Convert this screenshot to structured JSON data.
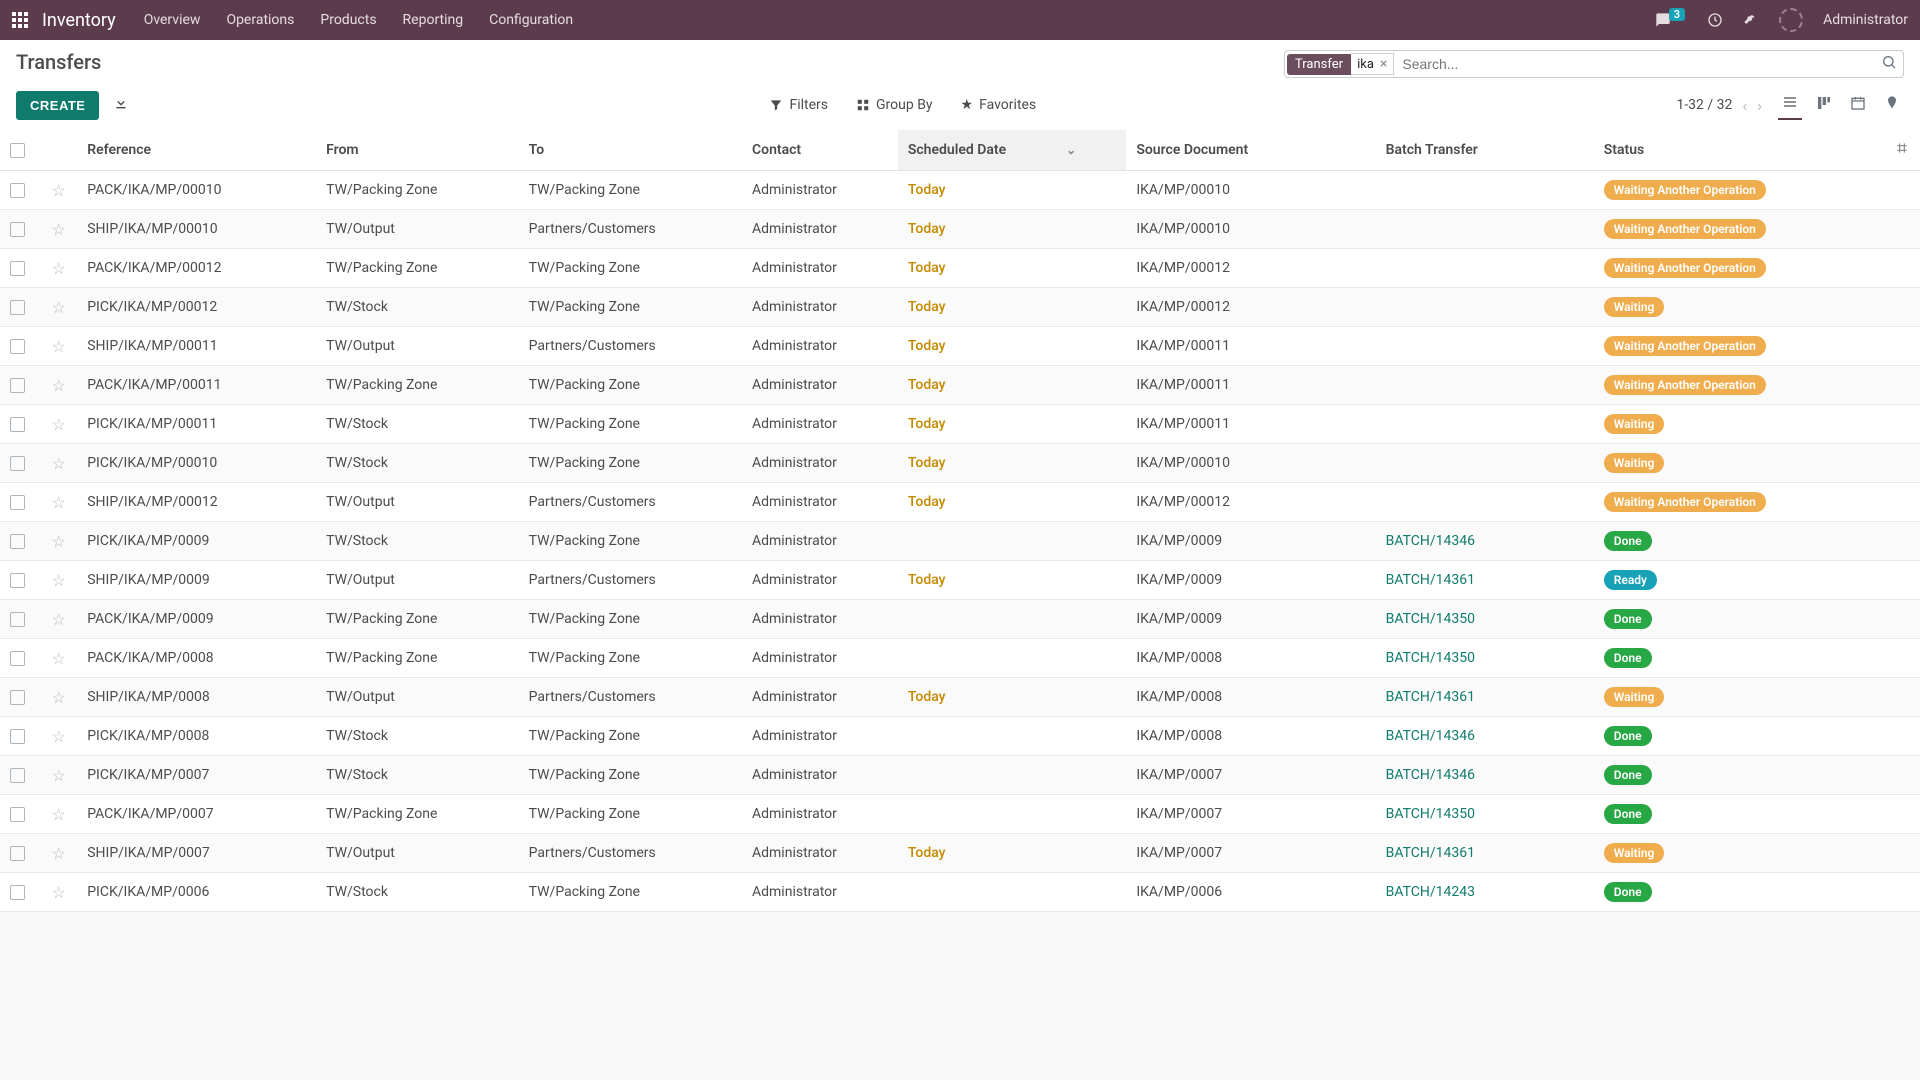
{
  "nav": {
    "brand": "Inventory",
    "menu": [
      "Overview",
      "Operations",
      "Products",
      "Reporting",
      "Configuration"
    ],
    "chat_count": "3",
    "user": "Administrator"
  },
  "page": {
    "title": "Transfers",
    "create": "CREATE",
    "filter_chip": {
      "label": "Transfer",
      "value": "ika"
    },
    "search_placeholder": "Search..."
  },
  "tools": {
    "filters": "Filters",
    "groupby": "Group By",
    "favorites": "Favorites",
    "pager": "1-32 / 32"
  },
  "columns": {
    "reference": "Reference",
    "from": "From",
    "to": "To",
    "contact": "Contact",
    "scheduled": "Scheduled Date",
    "source": "Source Document",
    "batch": "Batch Transfer",
    "status": "Status"
  },
  "status_labels": {
    "waitop": "Waiting Another Operation",
    "waiting": "Waiting",
    "done": "Done",
    "ready": "Ready"
  },
  "rows": [
    {
      "ref": "PACK/IKA/MP/00010",
      "from": "TW/Packing Zone",
      "to": "TW/Packing Zone",
      "contact": "Administrator",
      "date": "Today",
      "src": "IKA/MP/00010",
      "batch": "",
      "status": "waitop"
    },
    {
      "ref": "SHIP/IKA/MP/00010",
      "from": "TW/Output",
      "to": "Partners/Customers",
      "contact": "Administrator",
      "date": "Today",
      "src": "IKA/MP/00010",
      "batch": "",
      "status": "waitop"
    },
    {
      "ref": "PACK/IKA/MP/00012",
      "from": "TW/Packing Zone",
      "to": "TW/Packing Zone",
      "contact": "Administrator",
      "date": "Today",
      "src": "IKA/MP/00012",
      "batch": "",
      "status": "waitop"
    },
    {
      "ref": "PICK/IKA/MP/00012",
      "from": "TW/Stock",
      "to": "TW/Packing Zone",
      "contact": "Administrator",
      "date": "Today",
      "src": "IKA/MP/00012",
      "batch": "",
      "status": "waiting"
    },
    {
      "ref": "SHIP/IKA/MP/00011",
      "from": "TW/Output",
      "to": "Partners/Customers",
      "contact": "Administrator",
      "date": "Today",
      "src": "IKA/MP/00011",
      "batch": "",
      "status": "waitop"
    },
    {
      "ref": "PACK/IKA/MP/00011",
      "from": "TW/Packing Zone",
      "to": "TW/Packing Zone",
      "contact": "Administrator",
      "date": "Today",
      "src": "IKA/MP/00011",
      "batch": "",
      "status": "waitop"
    },
    {
      "ref": "PICK/IKA/MP/00011",
      "from": "TW/Stock",
      "to": "TW/Packing Zone",
      "contact": "Administrator",
      "date": "Today",
      "src": "IKA/MP/00011",
      "batch": "",
      "status": "waiting"
    },
    {
      "ref": "PICK/IKA/MP/00010",
      "from": "TW/Stock",
      "to": "TW/Packing Zone",
      "contact": "Administrator",
      "date": "Today",
      "src": "IKA/MP/00010",
      "batch": "",
      "status": "waiting"
    },
    {
      "ref": "SHIP/IKA/MP/00012",
      "from": "TW/Output",
      "to": "Partners/Customers",
      "contact": "Administrator",
      "date": "Today",
      "src": "IKA/MP/00012",
      "batch": "",
      "status": "waitop"
    },
    {
      "ref": "PICK/IKA/MP/0009",
      "from": "TW/Stock",
      "to": "TW/Packing Zone",
      "contact": "Administrator",
      "date": "",
      "src": "IKA/MP/0009",
      "batch": "BATCH/14346",
      "status": "done"
    },
    {
      "ref": "SHIP/IKA/MP/0009",
      "from": "TW/Output",
      "to": "Partners/Customers",
      "contact": "Administrator",
      "date": "Today",
      "src": "IKA/MP/0009",
      "batch": "BATCH/14361",
      "status": "ready"
    },
    {
      "ref": "PACK/IKA/MP/0009",
      "from": "TW/Packing Zone",
      "to": "TW/Packing Zone",
      "contact": "Administrator",
      "date": "",
      "src": "IKA/MP/0009",
      "batch": "BATCH/14350",
      "status": "done"
    },
    {
      "ref": "PACK/IKA/MP/0008",
      "from": "TW/Packing Zone",
      "to": "TW/Packing Zone",
      "contact": "Administrator",
      "date": "",
      "src": "IKA/MP/0008",
      "batch": "BATCH/14350",
      "status": "done"
    },
    {
      "ref": "SHIP/IKA/MP/0008",
      "from": "TW/Output",
      "to": "Partners/Customers",
      "contact": "Administrator",
      "date": "Today",
      "src": "IKA/MP/0008",
      "batch": "BATCH/14361",
      "status": "waiting"
    },
    {
      "ref": "PICK/IKA/MP/0008",
      "from": "TW/Stock",
      "to": "TW/Packing Zone",
      "contact": "Administrator",
      "date": "",
      "src": "IKA/MP/0008",
      "batch": "BATCH/14346",
      "status": "done"
    },
    {
      "ref": "PICK/IKA/MP/0007",
      "from": "TW/Stock",
      "to": "TW/Packing Zone",
      "contact": "Administrator",
      "date": "",
      "src": "IKA/MP/0007",
      "batch": "BATCH/14346",
      "status": "done"
    },
    {
      "ref": "PACK/IKA/MP/0007",
      "from": "TW/Packing Zone",
      "to": "TW/Packing Zone",
      "contact": "Administrator",
      "date": "",
      "src": "IKA/MP/0007",
      "batch": "BATCH/14350",
      "status": "done"
    },
    {
      "ref": "SHIP/IKA/MP/0007",
      "from": "TW/Output",
      "to": "Partners/Customers",
      "contact": "Administrator",
      "date": "Today",
      "src": "IKA/MP/0007",
      "batch": "BATCH/14361",
      "status": "waiting"
    },
    {
      "ref": "PICK/IKA/MP/0006",
      "from": "TW/Stock",
      "to": "TW/Packing Zone",
      "contact": "Administrator",
      "date": "",
      "src": "IKA/MP/0006",
      "batch": "BATCH/14243",
      "status": "done"
    }
  ]
}
